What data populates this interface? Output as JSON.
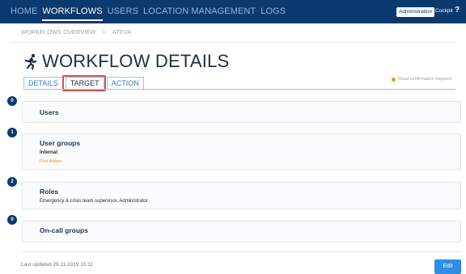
{
  "nav": {
    "items": [
      {
        "label": "HOME"
      },
      {
        "label": "WORKFLOWS"
      },
      {
        "label": "USERS"
      },
      {
        "label": "LOCATION MANAGEMENT"
      },
      {
        "label": "LOGS"
      }
    ],
    "active_index": 1,
    "admin_label": "Administration",
    "cockpit_label": "Cockpit",
    "help_label": "?"
  },
  "breadcrumb": {
    "items": [
      "WORKFLOWS OVERVIEW",
      "ATEVA"
    ],
    "separator": ">"
  },
  "page": {
    "title": "WORKFLOW DETAILS",
    "read_confirmation": "Read confirmation required"
  },
  "tabs": [
    {
      "label": "DETAILS"
    },
    {
      "label": "TARGET"
    },
    {
      "label": "ACTION"
    }
  ],
  "active_tab": 1,
  "sections": {
    "users": {
      "count": "0",
      "title": "Users"
    },
    "user_groups": {
      "count": "1",
      "title": "User groups",
      "internal_label": "Internal:",
      "group_link": "First Aiders"
    },
    "roles": {
      "count": "2",
      "title": "Roles",
      "roles_text": "Emergency & crisis team supervisor, Administrator"
    },
    "oncall": {
      "count": "0",
      "title": "On-call groups"
    }
  },
  "footer": {
    "last_updated": "Last updated 29.11.2019 15:11",
    "edit_label": "Edit"
  },
  "colors": {
    "topbar": "#0b3a6e",
    "accent": "#2f8de4",
    "warning": "#f0932b",
    "highlight": "#d9534f"
  }
}
